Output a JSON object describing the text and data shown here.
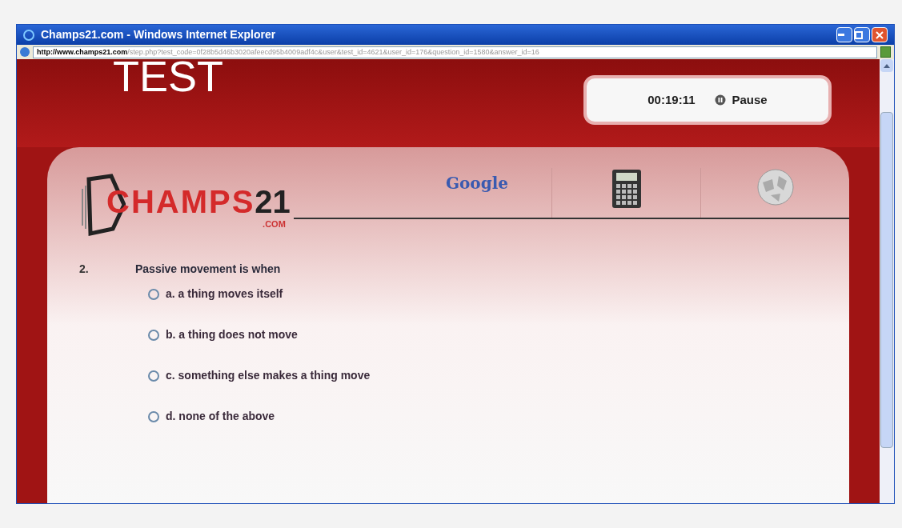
{
  "window": {
    "title": "Champs21.com - Windows Internet Explorer"
  },
  "address_bar": {
    "url_domain": "http://www.champs21.com",
    "url_path": "/step.php?test_code=0f28b5d46b3020afeecd95b4009adf4c&user&test_id=4621&user_id=176&question_id=1580&answer_id=16"
  },
  "header": {
    "title": "TEST",
    "timer": "00:19:11",
    "pause_button": "Pause"
  },
  "logo": {
    "name": "CHAMPS",
    "number": "21",
    "suffix": ".COM"
  },
  "tools": [
    {
      "kind": "google",
      "label": "Google"
    },
    {
      "kind": "calculator"
    },
    {
      "kind": "wiki"
    }
  ],
  "question": {
    "number": "2.",
    "text": "Passive movement is when",
    "options": [
      {
        "letter": "a.",
        "text": "a thing moves itself",
        "selected": false
      },
      {
        "letter": "b.",
        "text": "a thing does not move",
        "selected": false
      },
      {
        "letter": "c.",
        "text": "something else makes a thing move",
        "selected": false
      },
      {
        "letter": "d.",
        "text": "none of the above",
        "selected": false
      }
    ]
  }
}
